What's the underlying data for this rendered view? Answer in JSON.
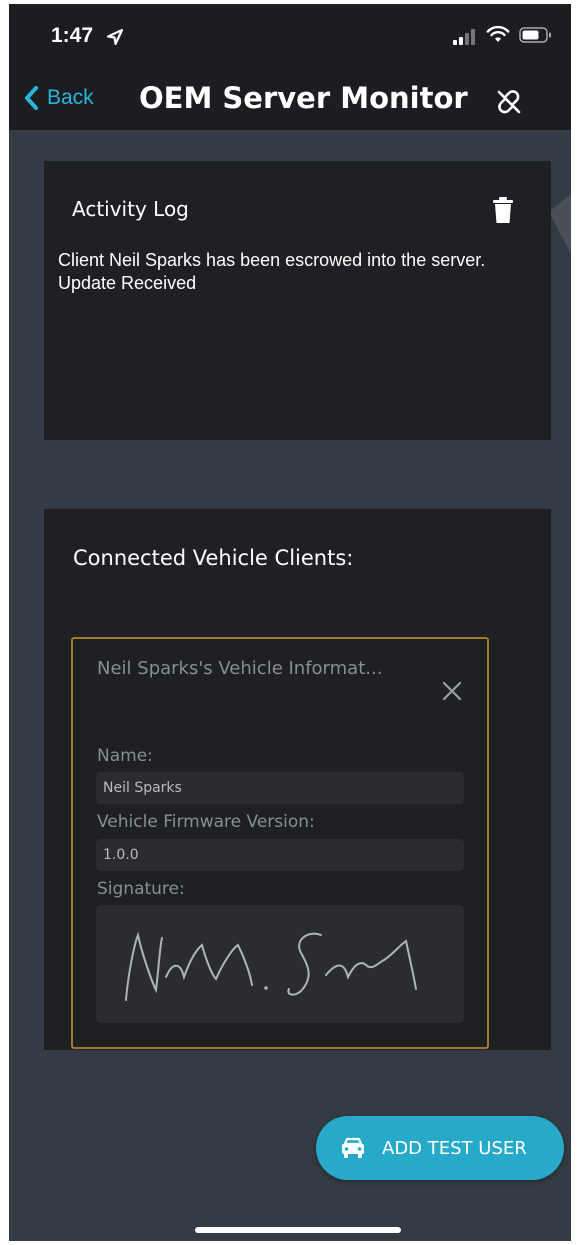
{
  "status_bar": {
    "time": "1:47",
    "icons": [
      "location-arrow-icon",
      "signal-icon",
      "wifi-icon",
      "battery-icon"
    ]
  },
  "nav": {
    "back_label": "Back",
    "title": "OEM Server Monitor",
    "icons": [
      "chevron-left-icon",
      "unlink-icon"
    ]
  },
  "activity_log": {
    "title": "Activity Log",
    "lines": [
      "Client Neil Sparks has been escrowed into the server.",
      "Update Received"
    ],
    "icons": [
      "trash-icon"
    ]
  },
  "clients": {
    "title": "Connected Vehicle Clients:",
    "card": {
      "title": "Neil Sparks's Vehicle Informat...",
      "name_label": "Name:",
      "name_value": "Neil Sparks",
      "firmware_label": "Vehicle Firmware Version:",
      "firmware_value": "1.0.0",
      "signature_label": "Signature:",
      "signature_text": "Neil Sparks",
      "icons": [
        "close-icon",
        "signature-image"
      ]
    }
  },
  "fab": {
    "label": "ADD TEST USER",
    "icons": [
      "car-icon"
    ]
  },
  "colors": {
    "accent": "#28b4dc",
    "fab": "#27a9c9",
    "card_border": "#9b7b2c",
    "panel": "#1e2023",
    "screen": "#353b44"
  }
}
